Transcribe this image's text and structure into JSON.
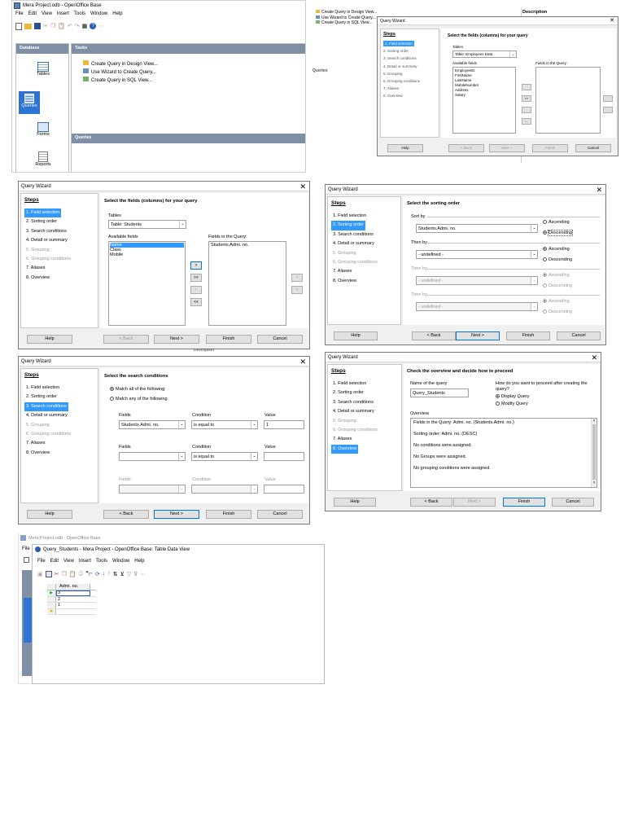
{
  "base_win": {
    "title": "Mera Project.odb - OpenOffice Base",
    "menu": [
      "File",
      "Edit",
      "View",
      "Insert",
      "Tools",
      "Window",
      "Help"
    ],
    "sidebar_header": "Database",
    "sidebar_items": [
      "Tables",
      "Queries",
      "Forms",
      "Reports"
    ],
    "tasks_header": "Tasks",
    "tasks": [
      "Create Query in Design View...",
      "Use Wizard to Create Query...",
      "Create Query in SQL View..."
    ],
    "lower_header": "Queries"
  },
  "topright": {
    "tasks": [
      "Create Query in Design View...",
      "Use Wizard to Create Query...",
      "Create Query in SQL View..."
    ],
    "description_label": "Description",
    "queries_label": "Queries"
  },
  "wizard_title": "Query Wizard",
  "steps_title": "Steps",
  "steps": [
    "1. Field selection",
    "2. Sorting order",
    "3. Search conditions",
    "4. Detail or summary",
    "5. Grouping",
    "6. Grouping conditions",
    "7. Aliases",
    "8. Overview"
  ],
  "buttons": {
    "help": "Help",
    "back": "< Back",
    "next": "Next >",
    "finish": "Finish",
    "cancel": "Cancel"
  },
  "wiz0": {
    "heading": "Select the fields (columns) for your query",
    "tables_label": "Tables",
    "table_value": "Table: Employees Data",
    "available_label": "Available fields",
    "available": [
      "EmployeeID",
      "FirstName",
      "LastName",
      "MobileNumber",
      "Address",
      "Salary"
    ],
    "fields_label": "Fields in the Query:"
  },
  "wiz1": {
    "heading": "Select the fields (columns) for your query",
    "tables_label": "Tables",
    "table_value": "Table: Students",
    "available_label": "Available fields",
    "available": [
      "Name",
      "Class",
      "Mobile"
    ],
    "fields_label": "Fields in the Query:",
    "fields": [
      "Students.Admi. no."
    ],
    "move_buttons": [
      ">",
      ">>",
      "<",
      "<<"
    ]
  },
  "wiz2": {
    "heading": "Select the sorting order",
    "sort_by": "Sort by",
    "then_by": "Then by",
    "sort_value": "Students.Admi. no.",
    "undefined": "- undefined -",
    "ascending": "Ascending",
    "descending": "Descending"
  },
  "wiz3": {
    "heading": "Select the search conditions",
    "match_all": "Match all of the following",
    "match_any": "Match any of the following",
    "fields_label": "Fields",
    "condition_label": "Condition",
    "value_label": "Value",
    "row1_field": "Students.Admi. no.",
    "row1_cond": "is equal to",
    "row1_value": "1",
    "row2_cond": "is equal to"
  },
  "wiz4": {
    "heading": "Check the overview and decide how to proceed",
    "name_label": "Name of the query",
    "name_value": "Query_Students",
    "proceed_label": "How do you want to proceed after creating the query?",
    "display": "Display Query",
    "modify": "Modify Query",
    "overview_label": "Overview",
    "overview_lines": [
      "Fields in the Query: Admi. no. (Students.Admi. no.)",
      "Sorting order: Admi. no. (DESC)",
      "No conditions were assigned.",
      "No Groups were assigned.",
      "No grouping conditions were assigned."
    ]
  },
  "datawin": {
    "back_title": "Mera Project.odb - OpenOffice Base",
    "title": "Query_Students - Mera Project - OpenOffice Base: Table Data View",
    "menu": [
      "File",
      "Edit",
      "View",
      "Insert",
      "Tools",
      "Window",
      "Help"
    ],
    "column": "Admi. no.",
    "rows": [
      "3",
      "2",
      "1"
    ],
    "partial_label": "Description"
  }
}
